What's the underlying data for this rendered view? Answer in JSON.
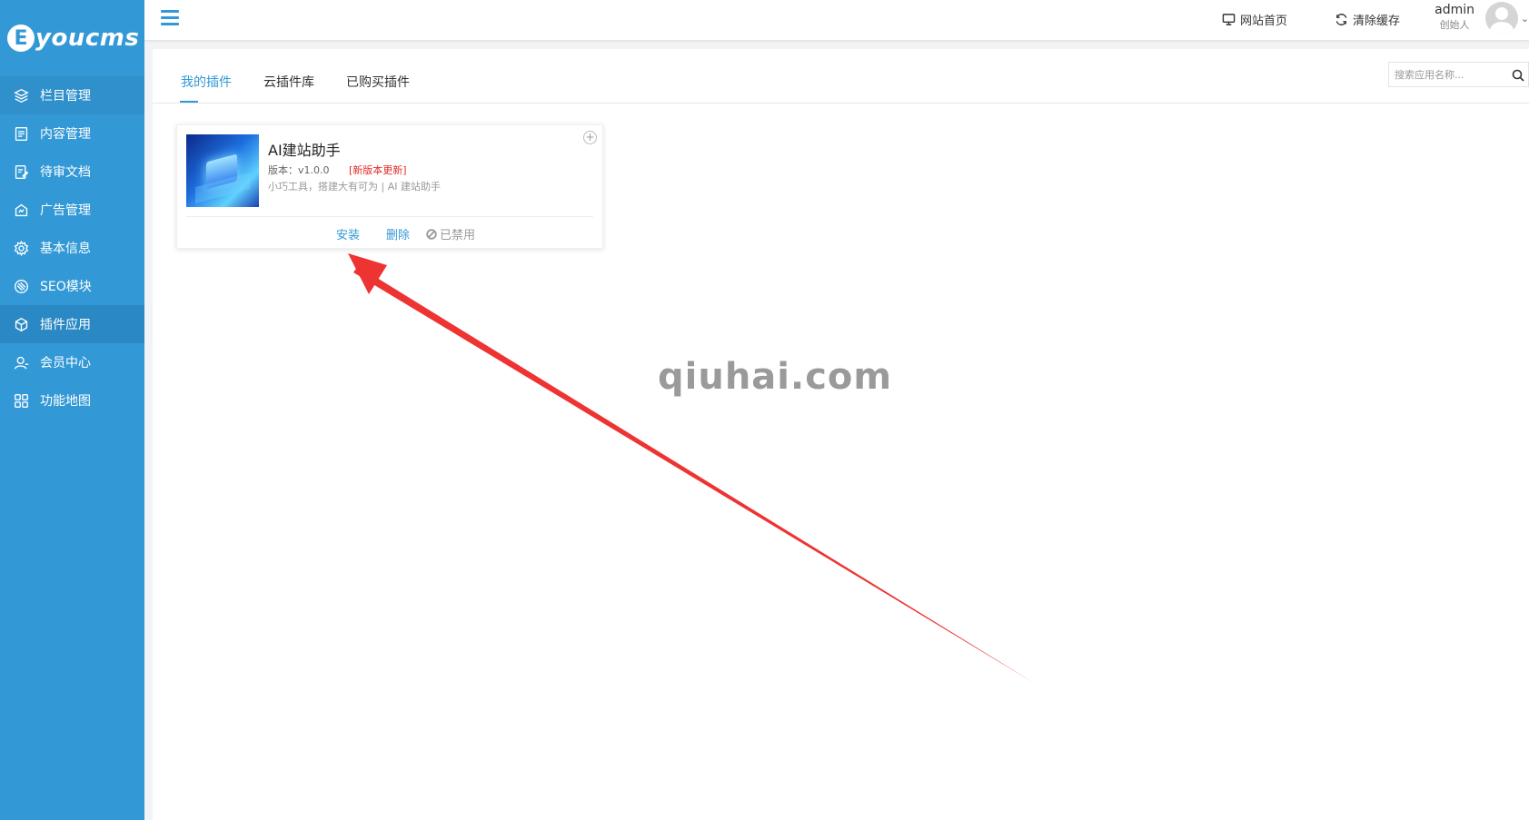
{
  "logo": {
    "letter": "E",
    "text": "youcms"
  },
  "sidebar": {
    "items": [
      {
        "label": "栏目管理",
        "icon": "layers-icon"
      },
      {
        "label": "内容管理",
        "icon": "document-icon"
      },
      {
        "label": "待审文档",
        "icon": "edit-document-icon"
      },
      {
        "label": "广告管理",
        "icon": "ad-icon"
      },
      {
        "label": "基本信息",
        "icon": "gear-icon"
      },
      {
        "label": "SEO模块",
        "icon": "seo-icon"
      },
      {
        "label": "插件应用",
        "icon": "cube-icon"
      },
      {
        "label": "会员中心",
        "icon": "user-icon"
      },
      {
        "label": "功能地图",
        "icon": "grid-icon"
      }
    ],
    "active_index": 6
  },
  "header": {
    "site_home": "网站首页",
    "clear_cache": "清除缓存",
    "user_name": "admin",
    "user_role": "创始人"
  },
  "tabs": [
    "我的插件",
    "云插件库",
    "已购买插件"
  ],
  "active_tab": 0,
  "search": {
    "placeholder": "搜索应用名称..."
  },
  "plugin": {
    "title": "AI建站助手",
    "version": "版本：v1.0.0",
    "update_badge": "[新版本更新]",
    "description": "小巧工具，搭建大有可为 | AI 建站助手",
    "install": "安装",
    "delete": "删除",
    "disabled": "已禁用"
  },
  "watermark": "qiuhai.com",
  "colors": {
    "sidebar": "#3399d6",
    "accent": "#3399d6",
    "update_red": "#e22b2b",
    "arrow_red": "#ee3333"
  }
}
